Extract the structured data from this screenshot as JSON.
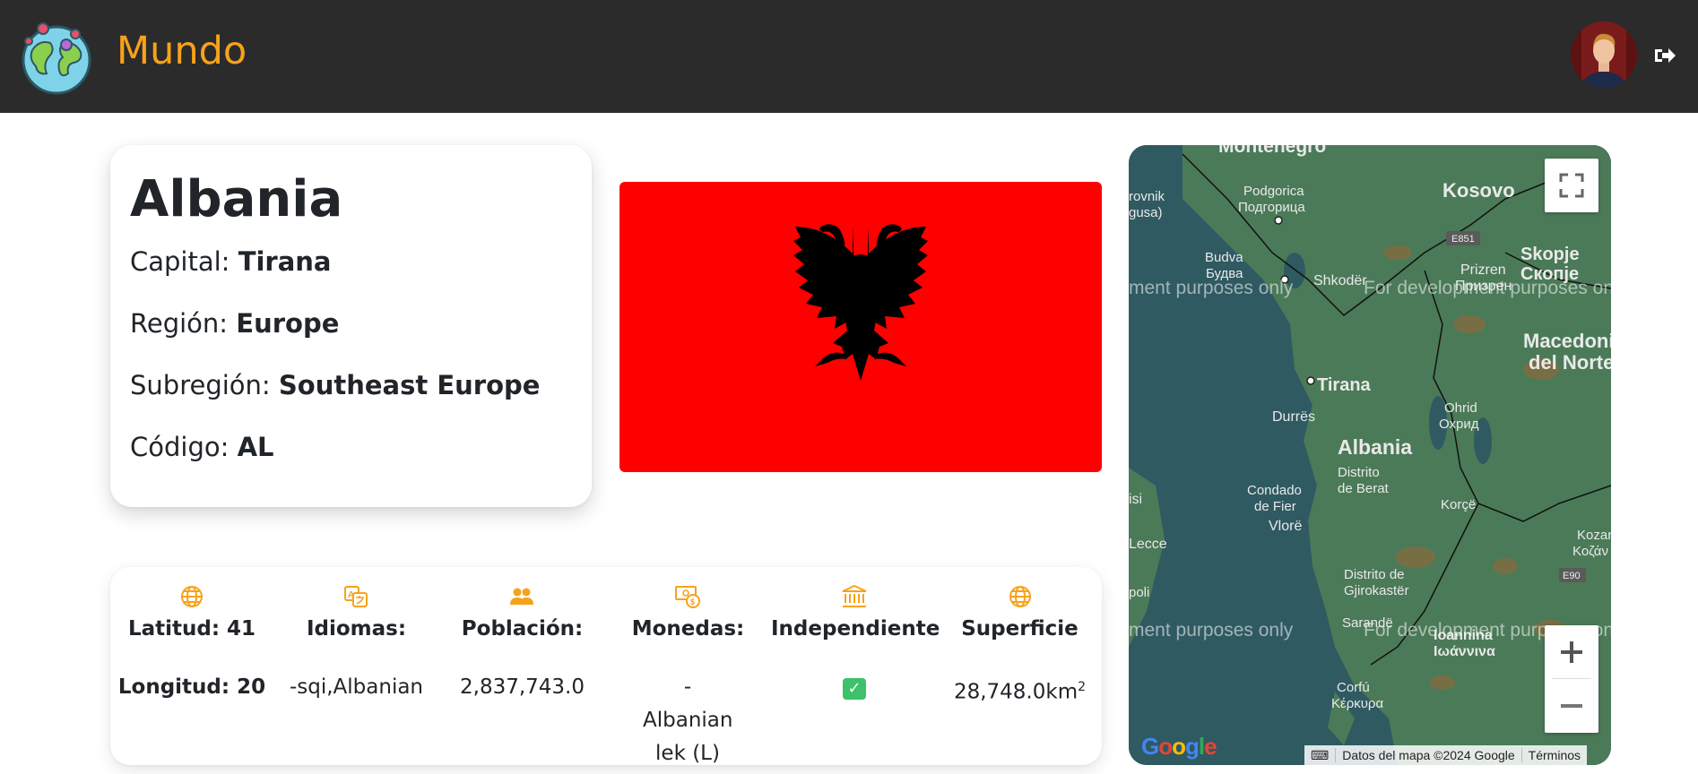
{
  "header": {
    "brand": "Mundo",
    "colors": {
      "background": "#2b2b2b",
      "brand": "#f7a21b"
    }
  },
  "country": {
    "name": "Albania",
    "capital_label": "Capital: ",
    "capital": "Tirana",
    "region_label": "Región: ",
    "region": "Europe",
    "subregion_label": "Subregión: ",
    "subregion": "Southeast Europe",
    "code_label": "Código: ",
    "code": "AL"
  },
  "stats": [
    {
      "icon": "globe-icon",
      "title": "Latitud: 41",
      "value": "Longitud: 20",
      "bold_value": true
    },
    {
      "icon": "translate-icon",
      "title": "Idiomas:",
      "value": "-sqi,Albanian"
    },
    {
      "icon": "people-icon",
      "title": "Población:",
      "value": "2,837,743.0"
    },
    {
      "icon": "currency-exchange-icon",
      "title": "Monedas:",
      "value": "-Albanian lek (L)"
    },
    {
      "icon": "bank-icon",
      "title": "Independiente",
      "value": "✓"
    },
    {
      "icon": "globe-icon",
      "title": "Superficie",
      "value": "28,748.0km",
      "unit_sup": "2"
    }
  ],
  "map": {
    "watermark": "For development purposes only",
    "watermark_left": "ment purposes only",
    "labels": [
      "Montenegro",
      "Kosovo",
      "Podgorica",
      "Подгорица",
      "Budva",
      "Будва",
      "rovnik",
      "gusa)",
      "Shkodër",
      "Prizren",
      "Призрен",
      "Skopje",
      "Скопје",
      "E851",
      "Macedonia",
      "del Norte",
      "Tirana",
      "Durrës",
      "Ohrid",
      "Охрид",
      "Albania",
      "Distrito",
      "de Berat",
      "Condado",
      "de Fier",
      "Vlorë",
      "Korçë",
      "isi",
      "Lecce",
      "Kozan",
      "Κοζάν",
      "Distrito de",
      "Gjirokastër",
      "E90",
      "poli",
      "Sarandë",
      "Ioannina",
      "Ιωάννινα",
      "Corfú",
      "Κέρκυρα"
    ],
    "attribution": "Datos del mapa ©2024 Google",
    "terms": "Términos",
    "google_logo": "Google"
  }
}
